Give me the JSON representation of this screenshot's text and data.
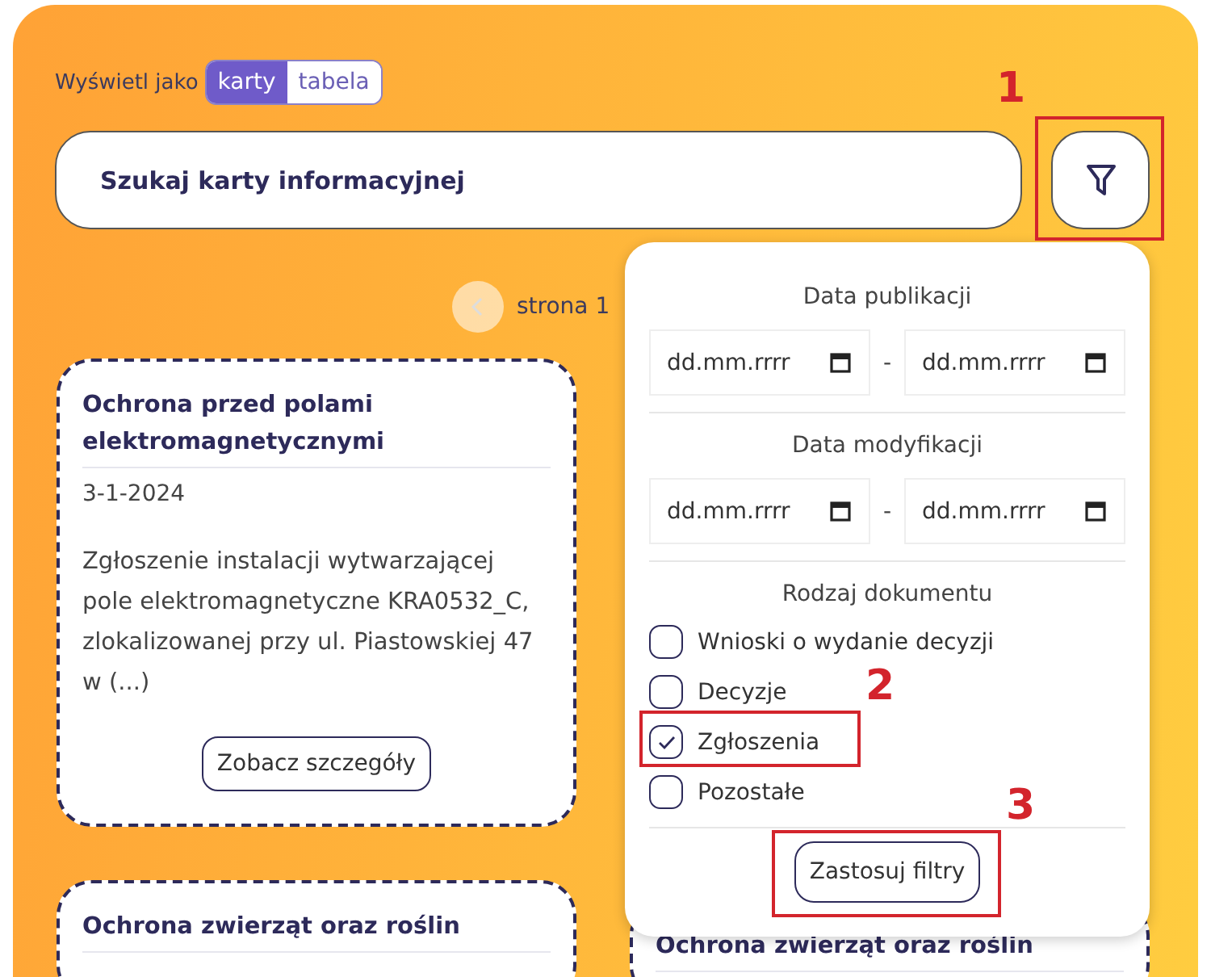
{
  "view_toggle": {
    "label": "Wyświetl jako",
    "options": [
      {
        "label": "karty",
        "selected": true
      },
      {
        "label": "tabela",
        "selected": false
      }
    ]
  },
  "search": {
    "placeholder": "Szukaj karty informacyjnej"
  },
  "pager": {
    "label": "strona 1"
  },
  "cards": [
    {
      "title": "Ochrona przed polami elektromagnetycznymi",
      "date": "3-1-2024",
      "description": "Zgłoszenie instalacji wytwarzającej pole elektromagnetyczne KRA0532_C, zlokalizowanej przy ul. Piastowskiej 47 w (...)",
      "button": "Zobacz szczegóły"
    },
    {
      "title": "Ochrona zwierząt oraz roślin"
    },
    {
      "title": "Ochrona zwierząt oraz roślin"
    }
  ],
  "filter_panel": {
    "sections": [
      {
        "kind": "dates",
        "title": "Data publikacji",
        "from": {
          "placeholder": "dd.mm.rrrr"
        },
        "separator": "-",
        "to": {
          "placeholder": "dd.mm.rrrr"
        }
      },
      {
        "kind": "dates",
        "title": "Data modyfikacji",
        "from": {
          "placeholder": "dd.mm.rrrr"
        },
        "separator": "-",
        "to": {
          "placeholder": "dd.mm.rrrr"
        }
      },
      {
        "kind": "checks",
        "title": "Rodzaj dokumentu",
        "options": [
          {
            "label": "Wnioski o wydanie decyzji",
            "checked": false
          },
          {
            "label": "Decyzje",
            "checked": false
          },
          {
            "label": "Zgłoszenia",
            "checked": true
          },
          {
            "label": "Pozostałe",
            "checked": false
          }
        ]
      }
    ],
    "apply_button": "Zastosuj filtry"
  },
  "annotations": [
    {
      "label": "1"
    },
    {
      "label": "2"
    },
    {
      "label": "3"
    }
  ]
}
